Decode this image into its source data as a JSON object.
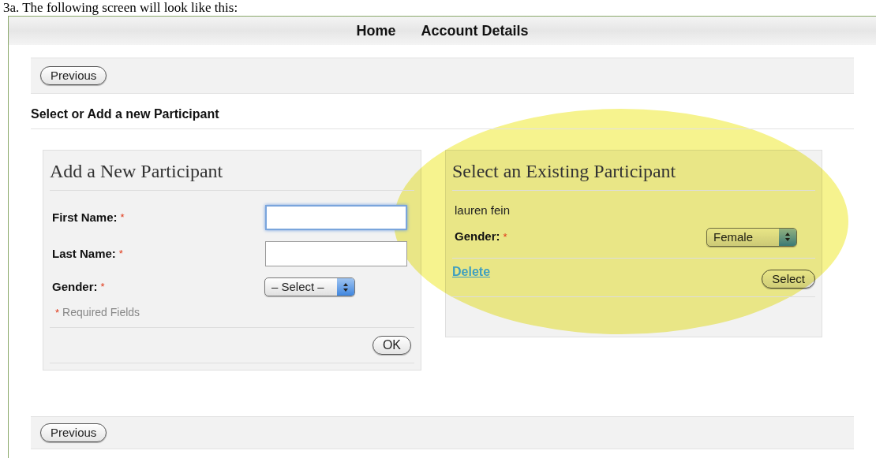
{
  "caption": "3a. The following screen will look like this:",
  "nav": [
    {
      "label": "Home"
    },
    {
      "label": "Account Details"
    }
  ],
  "top_button": "Previous",
  "section_title": "Select or Add a new Participant",
  "required_mark": "*",
  "new_participant": {
    "title": "Add a New Participant",
    "fields": [
      {
        "kind": "text",
        "label": "First Name:",
        "required": true,
        "focused": true
      },
      {
        "kind": "text",
        "label": "Last Name:",
        "required": true,
        "focused": false
      },
      {
        "kind": "select",
        "label": "Gender:",
        "required": true,
        "value": "– Select –"
      }
    ],
    "required_note": "Required Fields",
    "submit": "OK"
  },
  "existing": {
    "title": "Select an Existing Participant",
    "name": "lauren fein",
    "gender": {
      "label": "Gender:",
      "required": true,
      "value": "Female"
    },
    "delete": "Delete",
    "select": "Select"
  },
  "bottom_button": "Previous"
}
